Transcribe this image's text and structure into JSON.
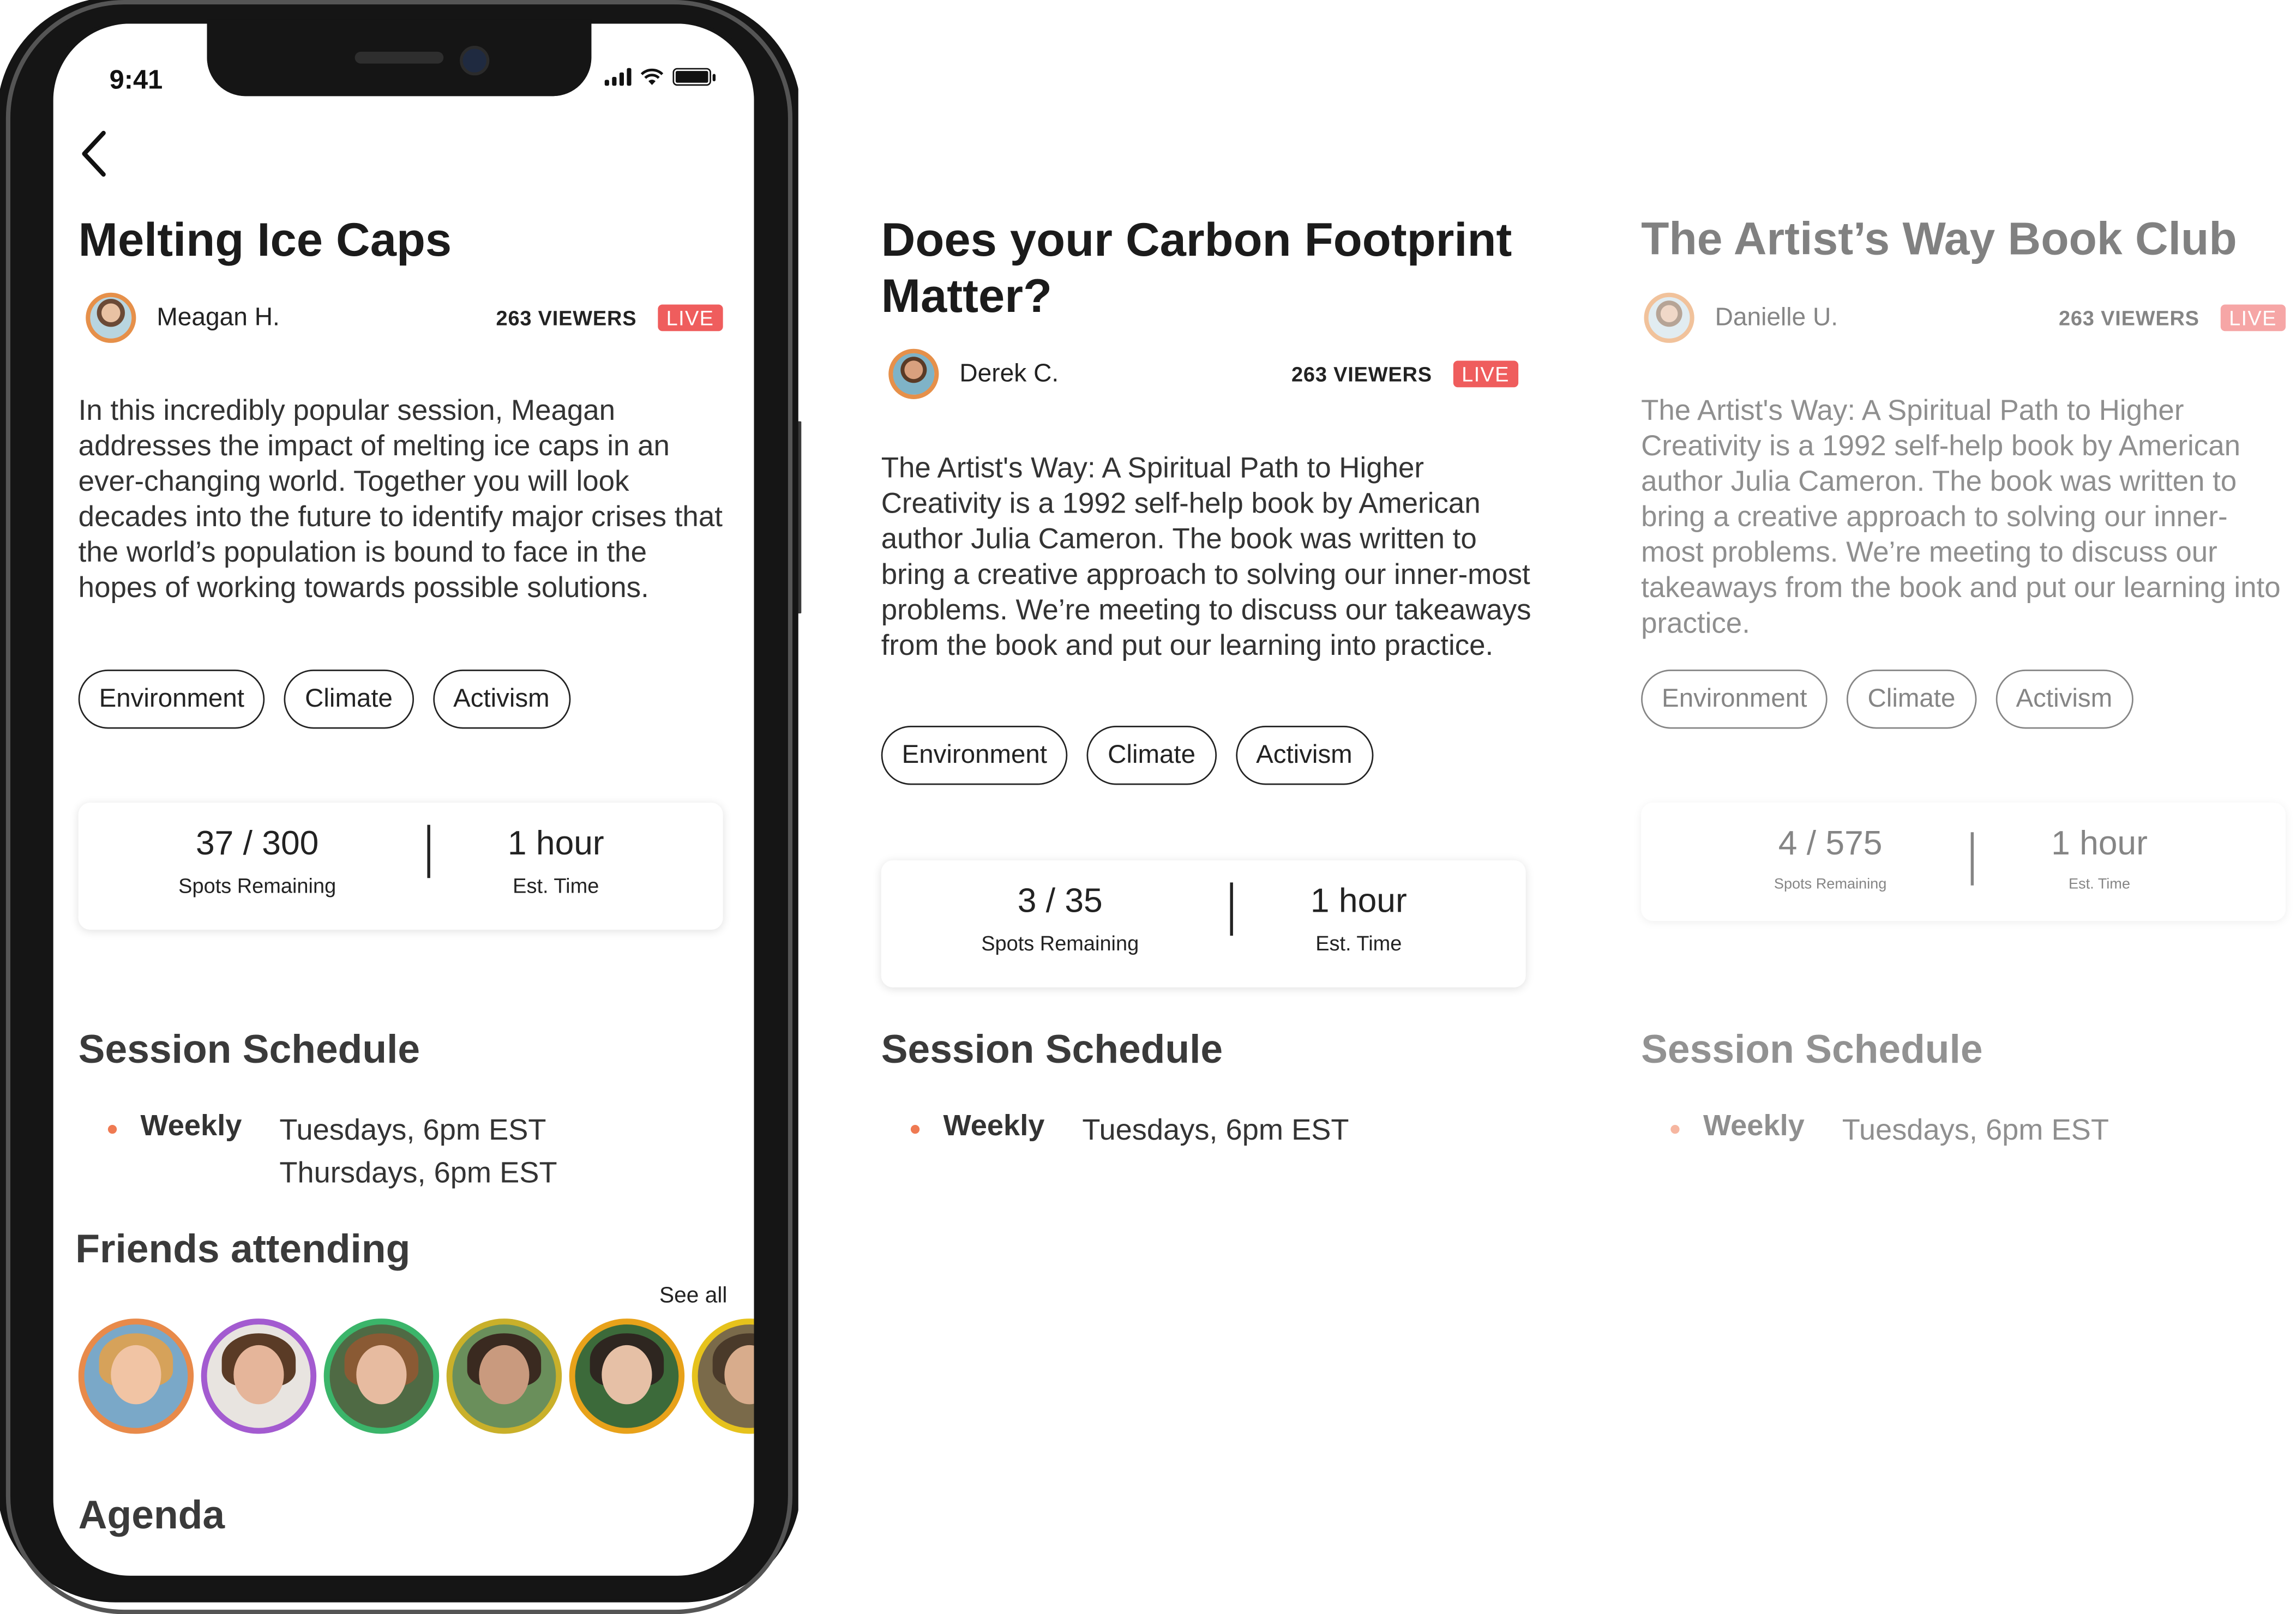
{
  "status_bar": {
    "time": "9:41"
  },
  "cards": [
    {
      "title": "Melting Ice Caps",
      "host": "Meagan H.",
      "viewers": "263 VIEWERS",
      "live": "LIVE",
      "description": "In this incredibly popular session, Meagan addresses the impact of melting ice caps in an ever-changing world. Together you will look decades into the future to identify major crises that the world’s population is bound to face in the hopes of working towards possible solutions.",
      "tags": [
        "Environment",
        "Climate",
        "Activism"
      ],
      "spots": "37 / 300",
      "spots_label": "Spots Remaining",
      "time": "1 hour",
      "time_label": "Est. Time",
      "schedule_title": "Session Schedule",
      "schedule_freq": "Weekly",
      "schedule_times": [
        "Tuesdays, 6pm EST",
        "Thursdays, 6pm EST"
      ]
    },
    {
      "title": "Does your Carbon Footprint Matter?",
      "host": "Derek C.",
      "viewers": "263 VIEWERS",
      "live": "LIVE",
      "description": "The Artist's Way: A Spiritual Path to Higher Creativity is a 1992 self-help book by American author Julia Cameron. The book was written to bring a creative approach to solving our inner-most problems. We’re meeting to discuss our takeaways from the book and put our learning into practice.",
      "tags": [
        "Environment",
        "Climate",
        "Activism"
      ],
      "spots": "3 / 35",
      "spots_label": "Spots Remaining",
      "time": "1 hour",
      "time_label": "Est. Time",
      "schedule_title": "Session Schedule",
      "schedule_freq": "Weekly",
      "schedule_times": [
        "Tuesdays, 6pm EST"
      ]
    },
    {
      "title": "The Artist’s Way Book Club",
      "host": "Danielle U.",
      "viewers": "263 VIEWERS",
      "live": "LIVE",
      "description": "The Artist's Way: A Spiritual Path to Higher Creativity is a 1992 self-help book by American author Julia Cameron. The book was written to bring a creative approach to solving our inner-most problems. We’re meeting to discuss our takeaways from the book and put our learning into practice.",
      "tags": [
        "Environment",
        "Climate",
        "Activism"
      ],
      "spots": "4 / 575",
      "spots_label": "Spots Remaining",
      "time": "1 hour",
      "time_label": "Est. Time",
      "schedule_title": "Session Schedule",
      "schedule_freq": "Weekly",
      "schedule_times": [
        "Tuesdays, 6pm EST"
      ]
    }
  ],
  "friends": {
    "title": "Friends attending",
    "see_all": "See all",
    "avatar_icons": [
      "friend-avatar",
      "friend-avatar",
      "friend-avatar",
      "friend-avatar",
      "friend-avatar",
      "friend-avatar"
    ]
  },
  "agenda_title": "Agenda",
  "colors": {
    "live": "#ef5d5d",
    "accent_dot": "#ef7a52"
  }
}
